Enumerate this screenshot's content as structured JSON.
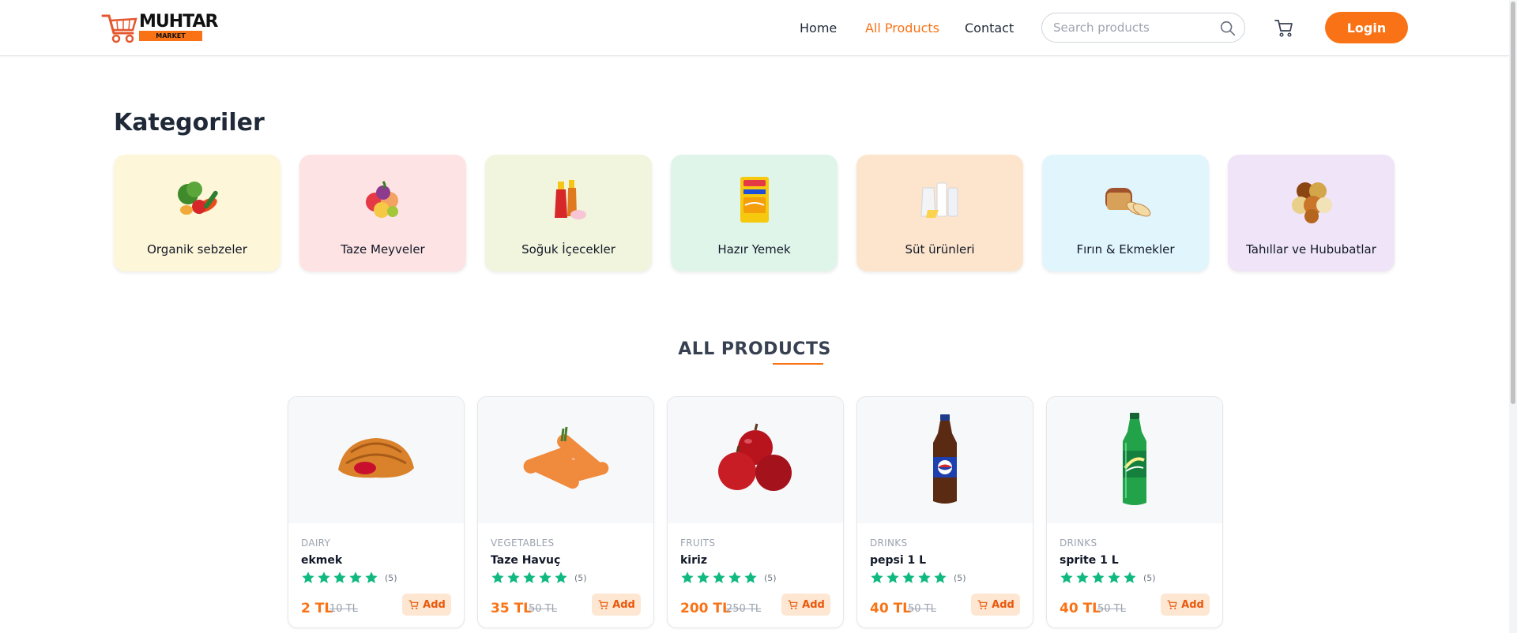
{
  "brand": {
    "name": "MUHTAR",
    "sub": "MARKET"
  },
  "nav": {
    "home": "Home",
    "all_products": "All Products",
    "contact": "Contact"
  },
  "search": {
    "placeholder": "Search products",
    "value": ""
  },
  "header": {
    "login_label": "Login"
  },
  "colors": {
    "accent": "#f97316",
    "star": "#10b981"
  },
  "categories": {
    "title": "Kategoriler",
    "items": [
      {
        "label": "Organik sebzeler",
        "bg": "#fef6d8",
        "icon": "vegetables-icon"
      },
      {
        "label": "Taze Meyveler",
        "bg": "#fde3e3",
        "icon": "fruits-icon"
      },
      {
        "label": "Soğuk İçecekler",
        "bg": "#f1f5dd",
        "icon": "drinks-icon"
      },
      {
        "label": "Hazır Yemek",
        "bg": "#e0f5ea",
        "icon": "instant-noodle-icon"
      },
      {
        "label": "Süt ürünleri",
        "bg": "#fde5cd",
        "icon": "dairy-icon"
      },
      {
        "label": "Fırın & Ekmekler",
        "bg": "#e1f5fd",
        "icon": "bread-icon"
      },
      {
        "label": "Tahıllar ve Hububatlar",
        "bg": "#f0e4f8",
        "icon": "grains-icon"
      }
    ]
  },
  "products": {
    "title": "ALL PRODUCTS",
    "add_label": "Add",
    "items": [
      {
        "category": "DAIRY",
        "name": "ekmek",
        "rating": 5,
        "reviews": "(5)",
        "price": "2 TL",
        "old_price": "10 TL",
        "image": "croissant-icon"
      },
      {
        "category": "VEGETABLES",
        "name": "Taze Havuç",
        "rating": 5,
        "reviews": "(5)",
        "price": "35 TL",
        "old_price": "50 TL",
        "image": "carrots-icon"
      },
      {
        "category": "FRUITS",
        "name": "kiriz",
        "rating": 5,
        "reviews": "(5)",
        "price": "200 TL",
        "old_price": "250 TL",
        "image": "apples-icon"
      },
      {
        "category": "DRINKS",
        "name": "pepsi 1 L",
        "rating": 5,
        "reviews": "(5)",
        "price": "40 TL",
        "old_price": "50 TL",
        "image": "pepsi-bottle-icon"
      },
      {
        "category": "DRINKS",
        "name": "sprite 1 L",
        "rating": 5,
        "reviews": "(5)",
        "price": "40 TL",
        "old_price": "50 TL",
        "image": "sprite-bottle-icon"
      }
    ]
  }
}
